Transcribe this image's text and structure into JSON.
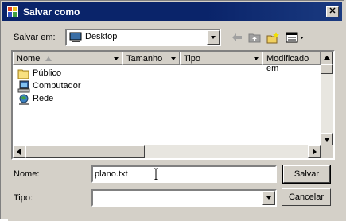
{
  "window": {
    "title": "Salvar como"
  },
  "location": {
    "label": "Salvar em:",
    "value": "Desktop"
  },
  "toolbar": {
    "icons": [
      "back-arrow-icon",
      "up-folder-icon",
      "new-folder-icon",
      "view-menu-icon"
    ]
  },
  "list": {
    "columns": [
      "Nome",
      "Tamanho",
      "Tipo",
      "Modificado em"
    ],
    "items": [
      {
        "label": "Público",
        "icon": "folder-icon"
      },
      {
        "label": "Computador",
        "icon": "computer-icon"
      },
      {
        "label": "Rede",
        "icon": "network-icon"
      }
    ]
  },
  "filename": {
    "label": "Nome:",
    "value": "plano.txt"
  },
  "filetype": {
    "label": "Tipo:",
    "value": ""
  },
  "buttons": {
    "save": "Salvar",
    "cancel": "Cancelar"
  }
}
